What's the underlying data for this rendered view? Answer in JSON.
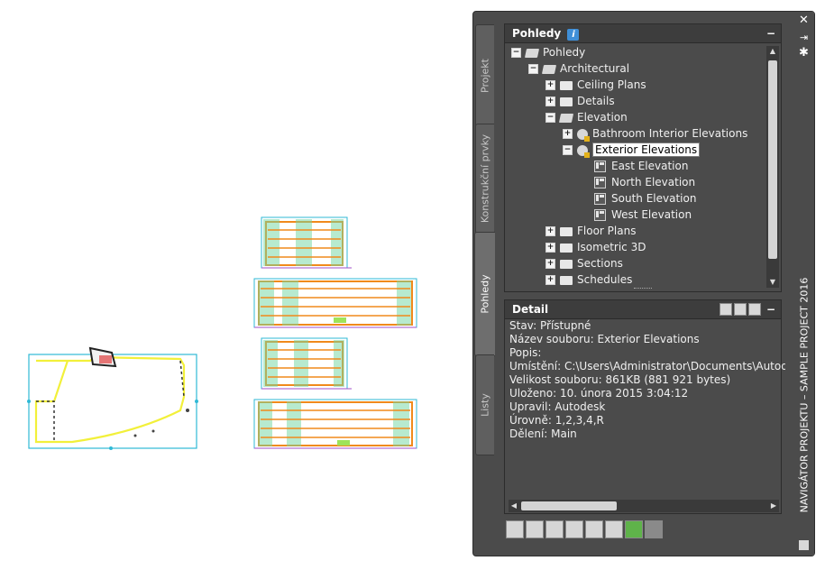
{
  "palette": {
    "title": "NAVIGÁTOR PROJEKTU – SAMPLE PROJECT 2016",
    "tabs": [
      "Projekt",
      "Konstrukční prvky",
      "Pohledy",
      "Listy"
    ],
    "active_tab": "Pohledy"
  },
  "views_panel": {
    "title": "Pohledy",
    "info_icon": "i",
    "tree": [
      {
        "label": "Pohledy",
        "expander": "−",
        "icon": "folder-open-icon"
      },
      {
        "label": "Architectural",
        "expander": "−",
        "icon": "folder-open-icon"
      },
      {
        "label": "Ceiling Plans",
        "expander": "+",
        "icon": "folder-icon"
      },
      {
        "label": "Details",
        "expander": "+",
        "icon": "folder-icon"
      },
      {
        "label": "Elevation",
        "expander": "−",
        "icon": "folder-open-icon"
      },
      {
        "label": "Bathroom Interior Elevations",
        "expander": "+",
        "icon": "view-group-icon"
      },
      {
        "label": "Exterior Elevations",
        "expander": "−",
        "icon": "view-group-icon",
        "selected": true
      },
      {
        "label": "East Elevation",
        "icon": "view-icon"
      },
      {
        "label": "North Elevation",
        "icon": "view-icon"
      },
      {
        "label": "South Elevation",
        "icon": "view-icon"
      },
      {
        "label": "West Elevation",
        "icon": "view-icon"
      },
      {
        "label": "Floor Plans",
        "expander": "+",
        "icon": "folder-icon"
      },
      {
        "label": "Isometric 3D",
        "expander": "+",
        "icon": "folder-icon"
      },
      {
        "label": "Sections",
        "expander": "+",
        "icon": "folder-icon"
      },
      {
        "label": "Schedules",
        "expander": "+",
        "icon": "folder-icon"
      }
    ]
  },
  "detail_panel": {
    "title": "Detail",
    "lines": [
      "Stav: Přístupné",
      "Název souboru: Exterior Elevations",
      "Popis:",
      "Umístění: C:\\Users\\Administrator\\Documents\\Autodesk\\",
      "Velikost souboru: 861KB (881 921 bytes)",
      "Uloženo: 10. února 2015  3:04:12",
      "Upravil: Autodesk",
      "Úrovně: 1,2,3,4,R",
      "Dělení: Main"
    ]
  },
  "colors": {
    "palette_bg": "#4b4b4b",
    "drawing_orange": "#f08a1c",
    "drawing_cyan": "#2fb9d6",
    "drawing_green": "#6fd6a0",
    "drawing_yellow": "#f2f03a"
  }
}
